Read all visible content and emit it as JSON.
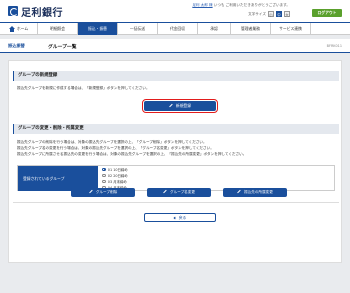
{
  "header": {
    "bank_name": "足利銀行",
    "user_line": "いつも ご利用いただきありがとうございます。",
    "user_name": "足利 太郎 様",
    "font_label": "文字サイズ",
    "font_sizes": [
      "小",
      "中",
      "大"
    ],
    "logout_label": "ログアウト"
  },
  "nav": {
    "items": [
      {
        "label": "ホーム"
      },
      {
        "label": "明細照会"
      },
      {
        "label": "振込・振替"
      },
      {
        "label": "一括伝送"
      },
      {
        "label": "代金回収"
      },
      {
        "label": "承認"
      },
      {
        "label": "管理者業務"
      },
      {
        "label": "サービス連携"
      }
    ]
  },
  "titlebar": {
    "breadcrumb": "振込振替",
    "title": "グループ一覧",
    "screen_id": "BFRK011"
  },
  "section_new": {
    "heading": "グループの新規登録",
    "desc": "振込先グループを新規に作成する場合は、「新規登録」ボタンを押してください。",
    "button": "新規登録"
  },
  "section_edit": {
    "heading": "グループの変更・削除・所属変更",
    "desc": [
      "振込先グループの削除を行う場合は、対象の振込先グループを選択の上、「グループ削除」ボタンを押してください。",
      "振込先グループ名の変更を行う場合は、対象の振込先グループを選択の上、「グループ名変更」ボタンを押してください。",
      "振込先グループに所属させる振込先の変更を行う場合は、対象の振込先グループを選択の上、「振込先の所属変更」ボタンを押してください。"
    ],
    "group_label": "登録されているグループ",
    "groups": [
      {
        "label": "01 10日締め",
        "checked": true
      },
      {
        "label": "02 20日締め",
        "checked": false
      },
      {
        "label": "03 月末締め",
        "checked": false
      },
      {
        "label": "04 月末締め",
        "checked": false
      }
    ],
    "buttons": {
      "delete": "グループ削除",
      "rename": "グループ名変更",
      "membership": "振込先の所属変更"
    }
  },
  "footer": {
    "back": "戻る"
  }
}
